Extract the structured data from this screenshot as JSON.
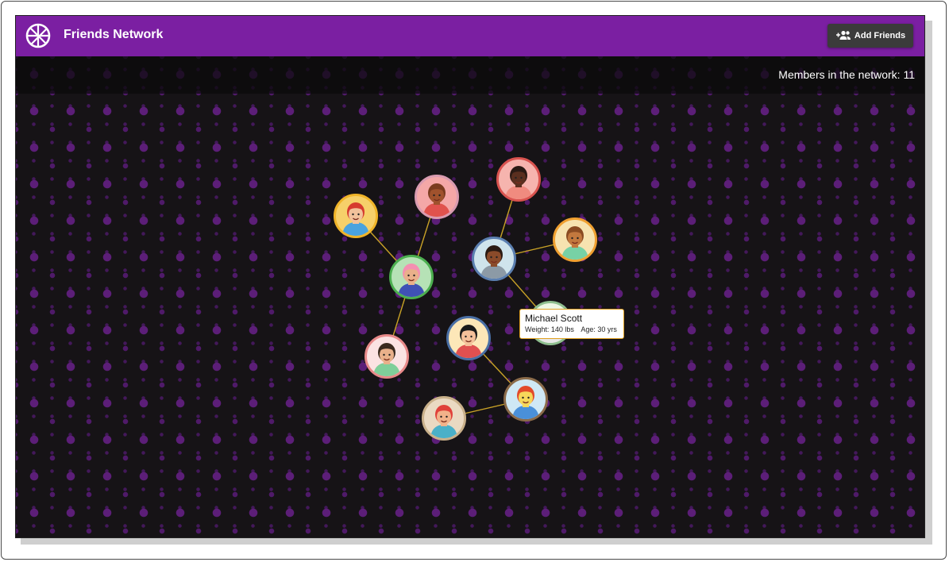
{
  "app": {
    "title": "Friends Network",
    "add_button_label": "Add Friends",
    "add_button_icon": "add-people-icon",
    "accent": "#7b1fa2"
  },
  "network": {
    "members_text": "Members in the network: 11",
    "edge_color": "#c9a227",
    "nodes": [
      {
        "id": "girl-sunglasses",
        "border": "#f0b429",
        "bg": "#f6d06a",
        "skin": "#f2c29b",
        "hair": "#d63b2f",
        "shirt": "#4aa3df"
      },
      {
        "id": "bearded-man",
        "border": "#d99bb0",
        "bg": "#f4a7a7",
        "skin": "#a0522d",
        "hair": "#7a3b1f",
        "shirt": "#e0524d"
      },
      {
        "id": "woman-headband",
        "border": "#d9534f",
        "bg": "#f6b4ae",
        "skin": "#5a2f1f",
        "hair": "#2b1a14",
        "shirt": "#f08b7f"
      },
      {
        "id": "curly-woman",
        "border": "#f0a030",
        "bg": "#f7e3b0",
        "skin": "#c2783e",
        "hair": "#8a4b22",
        "shirt": "#77d1a5"
      },
      {
        "id": "pink-hair-person",
        "border": "#4caf50",
        "bg": "#b6e2b6",
        "skin": "#e9b08a",
        "hair": "#f48fb1",
        "shirt": "#3f51b5"
      },
      {
        "id": "michael-scott",
        "border": "#5b7fb0",
        "bg": "#cfe4ec",
        "skin": "#8a4b2a",
        "hair": "#2a1a12",
        "shirt": "#8c9aa6"
      },
      {
        "id": "yellow-person",
        "border": "#8fbf8f",
        "bg": "#eef7e5",
        "skin": "#f7e06b",
        "hair": "#e8c84a",
        "shirt": "#e6e6e6"
      },
      {
        "id": "messy-hair-man",
        "border": "#e88a8a",
        "bg": "#fbe3e3",
        "skin": "#e9b08a",
        "hair": "#3a2a1e",
        "shirt": "#7fcf9a"
      },
      {
        "id": "dark-hair-man",
        "border": "#4a6fa5",
        "bg": "#fde7b8",
        "skin": "#f4c09a",
        "hair": "#1a1a1a",
        "shirt": "#e05050"
      },
      {
        "id": "red-hair-boy",
        "border": "#8b6b4a",
        "bg": "#cfe8f5",
        "skin": "#f7d75a",
        "hair": "#e24a2a",
        "shirt": "#4a90d9"
      },
      {
        "id": "braid-girl",
        "border": "#c9b08a",
        "bg": "#ead9c2",
        "skin": "#f2b28a",
        "hair": "#e0403a",
        "shirt": "#4ab0c8"
      }
    ]
  },
  "tooltip": {
    "name": "Michael Scott",
    "weight": "Weight: 140 lbs",
    "age": "Age: 30 yrs"
  }
}
